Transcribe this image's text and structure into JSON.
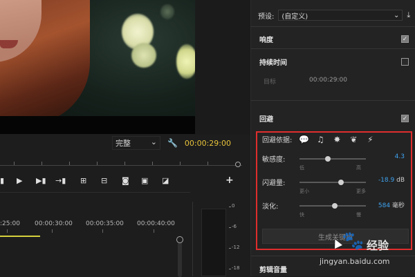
{
  "monitor": {
    "quality_select": "完整",
    "timecode": "00:00:29:00",
    "icons": [
      "wrench-icon",
      "play-icon",
      "step-back-icon",
      "step-forward-icon",
      "insert-icon",
      "lift-icon",
      "extract-icon",
      "camera-icon",
      "compare-icon",
      "overlay-icon",
      "add-icon"
    ]
  },
  "timeline": {
    "ruler_labels": [
      ":25:00",
      "00:00:30:00",
      "00:00:35:00",
      "00:00:40:00"
    ]
  },
  "meter": {
    "scale": [
      "0",
      "-6",
      "-12",
      "-18"
    ]
  },
  "panel": {
    "preset_label": "预设:",
    "preset_value": "(自定义)",
    "loudness_label": "响度",
    "loudness_checked": true,
    "duration_label": "持续时间",
    "duration_checked": false,
    "target_label": "目标",
    "target_timecode": "00:00:29:00",
    "ducking_label": "回避",
    "ducking_checked": true,
    "duck_basis_label": "回避依据:",
    "duck_basis_icons": [
      "dialogue-icon",
      "music-icon",
      "sfx-icon",
      "ambience-icon",
      "other-icon"
    ],
    "sensitivity": {
      "label": "敏感度:",
      "low": "低",
      "high": "高",
      "value": "4.3",
      "level": 0.43
    },
    "duck_amount": {
      "label": "闪避量:",
      "low": "更小",
      "high": "更多",
      "value": "-18.9",
      "unit": "dB",
      "level": 0.63
    },
    "fades": {
      "label": "淡化:",
      "low": "快",
      "high": "慢",
      "value": "584",
      "unit": "毫秒",
      "level": 0.53
    },
    "generate_button": "生成关键帧",
    "clip_volume_label": "剪辑音量"
  },
  "watermark": {
    "brand": "经验",
    "url": "jingyan.baidu.com"
  },
  "colors": {
    "accent_blue": "#3ea3f0",
    "highlight_red": "#e02d2d",
    "timecode_yellow": "#e8c33a",
    "workarea_yellow": "#d6d23c"
  }
}
